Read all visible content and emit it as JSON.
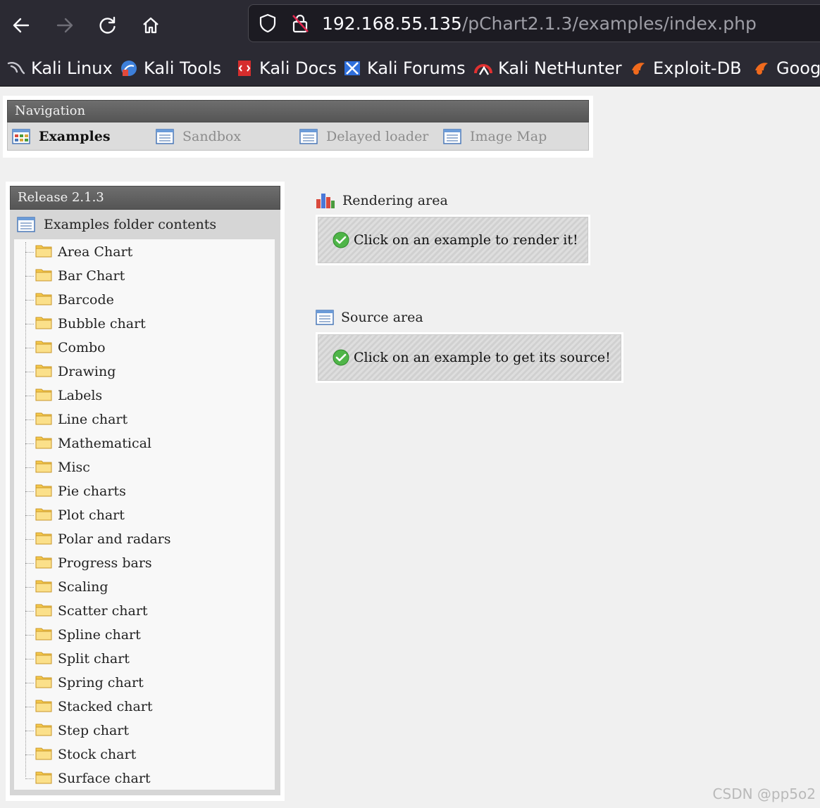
{
  "browser": {
    "url_host": "192.168.55.135",
    "url_path": "/pChart2.1.3/examples/index.php",
    "bookmarks": [
      {
        "label": "Kali Linux",
        "icon": "kali-dragon-icon"
      },
      {
        "label": "Kali Tools",
        "icon": "kali-tools-icon"
      },
      {
        "label": "Kali Docs",
        "icon": "kali-docs-icon"
      },
      {
        "label": "Kali Forums",
        "icon": "kali-forums-icon"
      },
      {
        "label": "Kali NetHunter",
        "icon": "kali-nethunter-icon"
      },
      {
        "label": "Exploit-DB",
        "icon": "exploit-db-icon"
      },
      {
        "label": "Goog",
        "icon": "google-hacking-db-icon"
      }
    ]
  },
  "nav": {
    "title": "Navigation",
    "items": [
      {
        "label": "Examples",
        "active": true
      },
      {
        "label": "Sandbox",
        "active": false
      },
      {
        "label": "Delayed loader",
        "active": false
      },
      {
        "label": "Image Map",
        "active": false
      }
    ]
  },
  "release": {
    "title": "Release 2.1.3",
    "folder_label": "Examples folder contents",
    "items": [
      "Area Chart",
      "Bar Chart",
      "Barcode",
      "Bubble chart",
      "Combo",
      "Drawing",
      "Labels",
      "Line chart",
      "Mathematical",
      "Misc",
      "Pie charts",
      "Plot chart",
      "Polar and radars",
      "Progress bars",
      "Scaling",
      "Scatter chart",
      "Spline chart",
      "Split chart",
      "Spring chart",
      "Stacked chart",
      "Step chart",
      "Stock chart",
      "Surface chart"
    ]
  },
  "rendering": {
    "title": "Rendering area",
    "message": "Click on an example to render it!"
  },
  "source": {
    "title": "Source area",
    "message": "Click on an example to get its source!"
  },
  "watermark": "CSDN @pp5o2"
}
